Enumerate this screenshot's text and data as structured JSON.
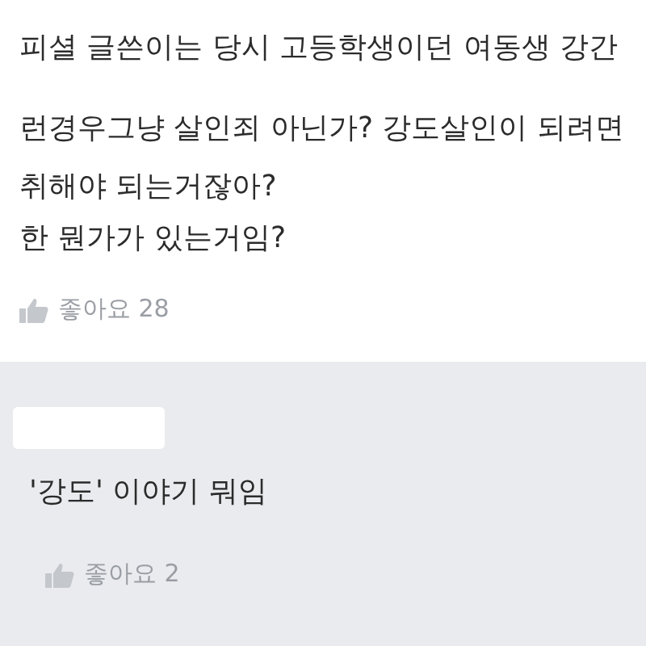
{
  "post_comment": {
    "lines": [
      "피셜 글쓴이는 당시 고등학생이던 여동생 강간",
      "런경우그냥 살인죄 아닌가? 강도살인이 되려면",
      "취해야 되는거잖아?",
      "한 뭔가가 있는거임?"
    ],
    "like_label": "좋아요 28"
  },
  "reply": {
    "text": "'강도' 이야기 뭐임",
    "like_label": "좋아요 2"
  }
}
